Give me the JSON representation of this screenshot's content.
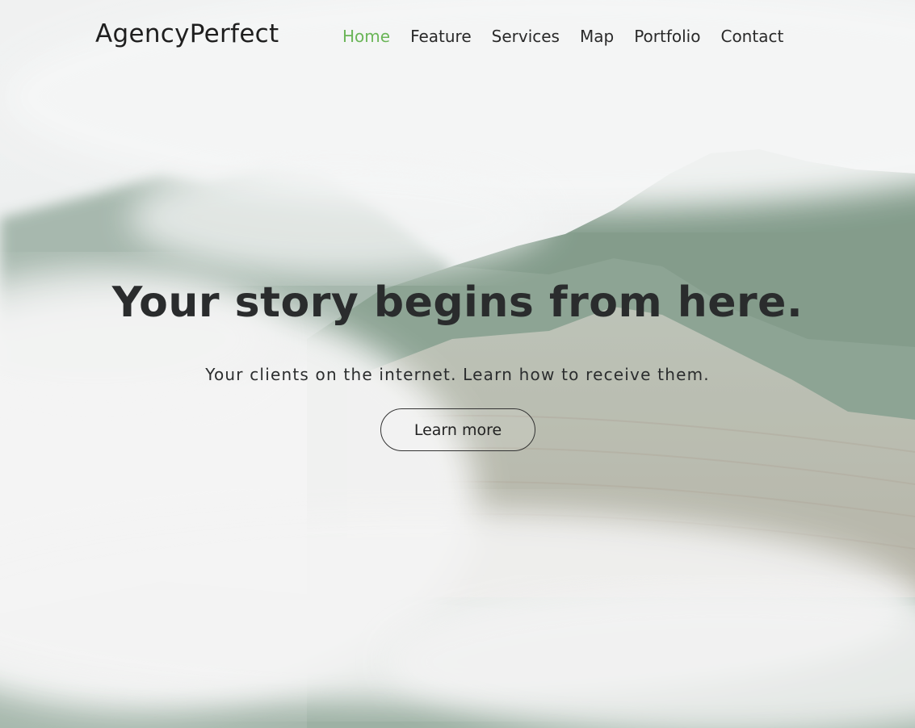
{
  "brand": {
    "name": "AgencyPerfect"
  },
  "nav": {
    "items": [
      {
        "label": "Home",
        "active": true
      },
      {
        "label": "Feature",
        "active": false
      },
      {
        "label": "Services",
        "active": false
      },
      {
        "label": "Map",
        "active": false
      },
      {
        "label": "Portfolio",
        "active": false
      },
      {
        "label": "Contact",
        "active": false
      }
    ]
  },
  "hero": {
    "headline": "Your story begins from here.",
    "subline": "Your clients on the internet. Learn how to receive them.",
    "cta_label": "Learn more"
  },
  "colors": {
    "accent": "#6ab557",
    "text": "#222222",
    "mountain": "#7f9a8a",
    "cliff": "#c9c3b4",
    "mist": "#f1f2f2"
  }
}
